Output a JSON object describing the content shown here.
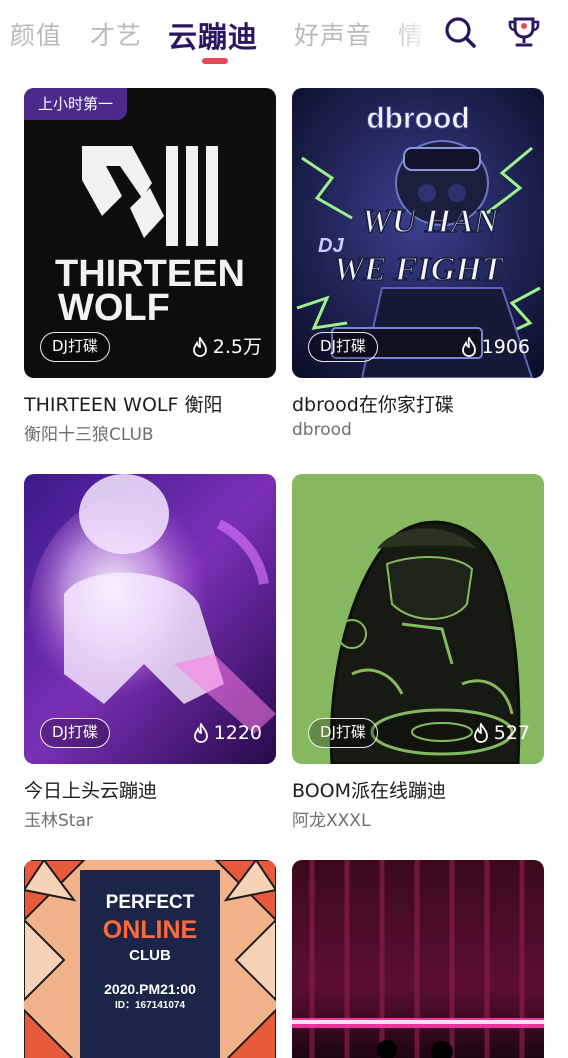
{
  "tabs": [
    "颜值",
    "才艺",
    "云蹦迪",
    "好声音",
    "情"
  ],
  "cards": [
    {
      "badge": "上小时第一",
      "art_text": [
        "THIRTEEN",
        "WOLF"
      ],
      "tag": "DJ打碟",
      "heat": "2.5万",
      "title": "THIRTEEN WOLF 衡阳",
      "subtitle": "衡阳十三狼CLUB"
    },
    {
      "art_text": [
        "dbrood",
        "WU HAN",
        "WE FIGHT",
        "DJ"
      ],
      "tag": "DJ打碟",
      "heat": "1906",
      "title": "dbrood在你家打碟",
      "subtitle": "dbrood"
    },
    {
      "tag": "DJ打碟",
      "heat": "1220",
      "title": "今日上头云蹦迪",
      "subtitle": "玉林Star"
    },
    {
      "tag": "DJ打碟",
      "heat": "527",
      "title": "BOOM派在线蹦迪",
      "subtitle": "阿龙XXXL"
    },
    {
      "art_text": [
        "PERFECT",
        "ONLINE",
        "CLUB",
        "2020.PM21:00",
        "ID：167141074"
      ]
    },
    {}
  ],
  "icons": {
    "search": "search-icon",
    "trophy": "trophy-icon",
    "flame": "flame-icon"
  },
  "colors": {
    "active_tab": "#2a1660",
    "inactive_tab": "#b9b9be",
    "indicator": "#e8475f",
    "badge": "#4b2a8c"
  }
}
